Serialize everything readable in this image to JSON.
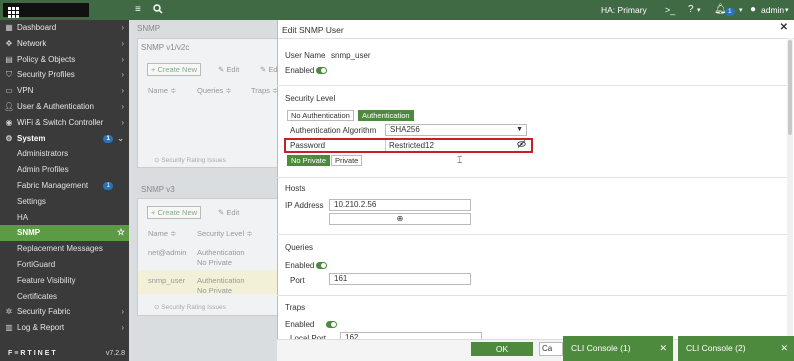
{
  "topbar": {
    "ha_status": "HA: Primary",
    "notification_count": "1",
    "user": "admin",
    "colors": {
      "bar": "#3f6a44",
      "badge": "#2a73b8"
    }
  },
  "sidebar": {
    "items": [
      {
        "label": "Dashboard",
        "icon": "dashboard-icon",
        "chevron": true
      },
      {
        "label": "Network",
        "icon": "network-icon",
        "chevron": true
      },
      {
        "label": "Policy & Objects",
        "icon": "policy-icon",
        "chevron": true
      },
      {
        "label": "Security Profiles",
        "icon": "shield-icon",
        "chevron": true
      },
      {
        "label": "VPN",
        "icon": "vpn-icon",
        "chevron": true
      },
      {
        "label": "User & Authentication",
        "icon": "user-icon",
        "chevron": true
      },
      {
        "label": "WiFi & Switch Controller",
        "icon": "wifi-icon",
        "chevron": true
      },
      {
        "label": "System",
        "icon": "gear-icon",
        "badge": "1",
        "expanded": true
      },
      {
        "label": "Administrators"
      },
      {
        "label": "Admin Profiles"
      },
      {
        "label": "Fabric Management",
        "badge": "1"
      },
      {
        "label": "Settings"
      },
      {
        "label": "HA"
      },
      {
        "label": "SNMP",
        "active": true
      },
      {
        "label": "Replacement Messages"
      },
      {
        "label": "FortiGuard"
      },
      {
        "label": "Feature Visibility"
      },
      {
        "label": "Certificates"
      },
      {
        "label": "Security Fabric",
        "icon": "fabric-icon",
        "chevron": true
      },
      {
        "label": "Log & Report",
        "icon": "log-icon",
        "chevron": true
      }
    ],
    "footer_brand": "F≡RTINET",
    "version": "v7.2.8"
  },
  "background": {
    "page_title": "SNMP",
    "v1_heading": "SNMP v1/v2c",
    "v3_heading": "SNMP v3",
    "create_new": "+ Create New",
    "edit": "✎ Edit",
    "edit_cut": "✎ Ed",
    "col_name": "Name ≑",
    "col_queries": "Queries ≑",
    "col_traps": "Traps ≑",
    "col_security": "Security Level ≑",
    "rating": "⊙ Security Rating Issues",
    "row1_name": "net@admin",
    "row1_level": "Authentication",
    "row1_priv": "No Private",
    "row2_name": "snmp_user",
    "row2_level": "Authentication",
    "row2_priv": "No Private"
  },
  "edit_panel": {
    "title": "Edit SNMP User",
    "username_label": "User Name",
    "username_value": "snmp_user",
    "enabled_label": "Enabled",
    "security_level_heading": "Security Level",
    "seg_no_auth": "No Authentication",
    "seg_auth": "Authentication",
    "auth_algo_label": "Authentication Algorithm",
    "auth_algo_value": "SHA256",
    "password_label": "Password",
    "password_value": "Restricted12",
    "seg_no_private": "No Private",
    "seg_private": "Private",
    "hosts_heading": "Hosts",
    "ip_label": "IP Address",
    "ip_value": "10.210.2.56",
    "queries_heading": "Queries",
    "queries_enabled_label": "Enabled",
    "port_label": "Port",
    "port_value": "161",
    "traps_heading": "Traps",
    "traps_enabled_label": "Enabled",
    "local_port_label": "Local Port",
    "local_port_value": "162",
    "ok_label": "OK",
    "cancel_label": "Ca"
  },
  "cli": {
    "console1": "CLI Console (1)",
    "console2": "CLI Console (2)"
  }
}
